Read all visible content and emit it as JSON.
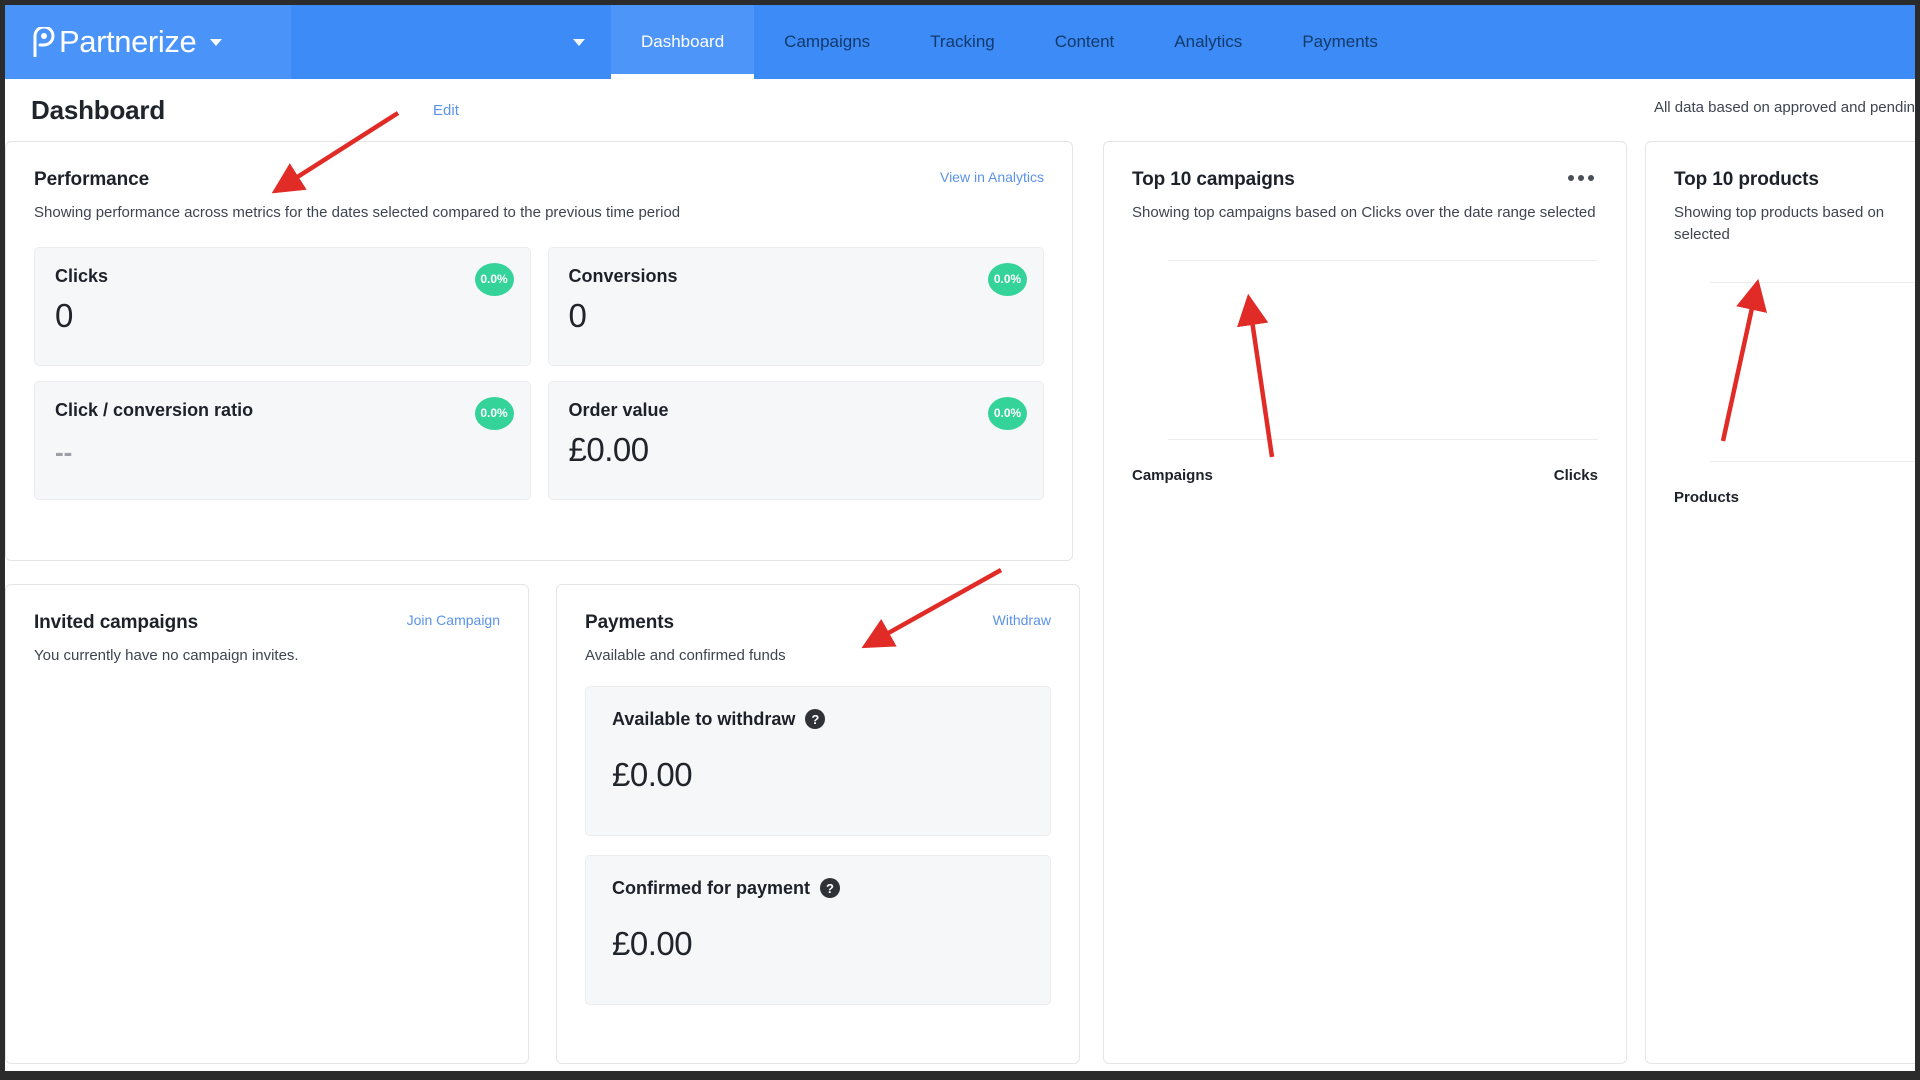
{
  "nav": {
    "brand": "Partnerize",
    "brand_caret": "chevron-down",
    "account_caret": "chevron-down",
    "tabs": [
      {
        "label": "Dashboard",
        "active": true
      },
      {
        "label": "Campaigns",
        "active": false
      },
      {
        "label": "Tracking",
        "active": false
      },
      {
        "label": "Content",
        "active": false
      },
      {
        "label": "Analytics",
        "active": false
      },
      {
        "label": "Payments",
        "active": false
      }
    ]
  },
  "header": {
    "title": "Dashboard",
    "edit_label": "Edit",
    "data_note": "All data based on approved and pendin"
  },
  "performance": {
    "title": "Performance",
    "subtitle": "Showing performance across metrics for the dates selected compared to the previous time period",
    "link_label": "View in Analytics",
    "metrics": [
      {
        "label": "Clicks",
        "value": "0",
        "badge": "0.0%"
      },
      {
        "label": "Conversions",
        "value": "0",
        "badge": "0.0%"
      },
      {
        "label": "Click / conversion ratio",
        "value": "--",
        "badge": "0.0%"
      },
      {
        "label": "Order value",
        "value": "£0.00",
        "badge": "0.0%"
      }
    ]
  },
  "invited": {
    "title": "Invited campaigns",
    "link_label": "Join Campaign",
    "empty_text": "You currently have no campaign invites."
  },
  "payments": {
    "title": "Payments",
    "link_label": "Withdraw",
    "subtitle": "Available and confirmed funds",
    "tiles": [
      {
        "label": "Available to withdraw",
        "help": "?",
        "value": "£0.00"
      },
      {
        "label": "Confirmed for payment",
        "help": "?",
        "value": "£0.00"
      }
    ]
  },
  "top_campaigns": {
    "title": "Top 10 campaigns",
    "subtitle": "Showing top campaigns based on Clicks over the date range selected",
    "menu": "more-options",
    "axis_left": "Campaigns",
    "axis_right": "Clicks"
  },
  "top_products": {
    "title": "Top 10 products",
    "subtitle": "Showing top products based on",
    "subtitle_line2": "selected",
    "axis_left": "Products"
  },
  "colors": {
    "nav_blue": "#3d8bf7",
    "nav_blue_light": "#4d95f8",
    "link_blue": "#5b93e8",
    "badge_green": "#34d39a",
    "annotation_red": "#e12b26",
    "tile_grey": "#f6f7f8",
    "text_dark": "#1d2129"
  }
}
